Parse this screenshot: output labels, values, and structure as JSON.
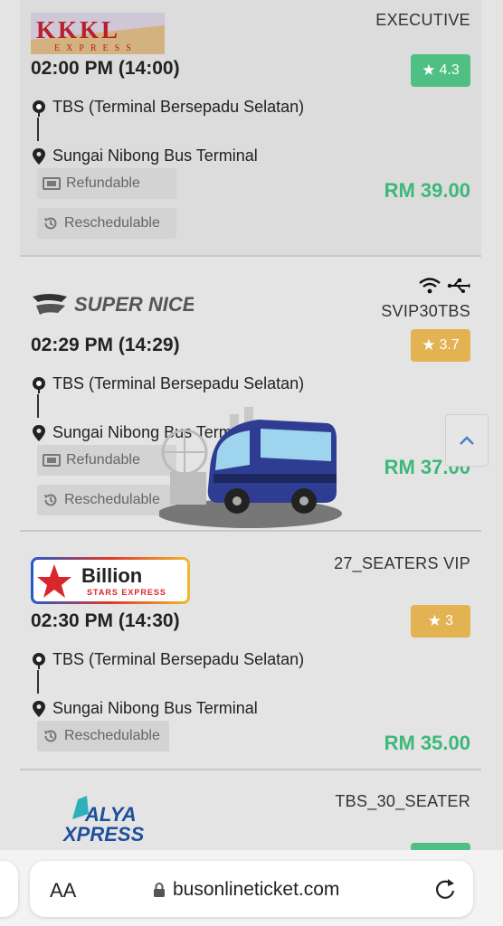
{
  "cards": [
    {
      "operator": "KKKL Express",
      "logo_text": "KKKL",
      "logo_sub": "EXPRESS",
      "bus_type": "EXECUTIVE",
      "time": "02:00 PM (14:00)",
      "rating": "4.3",
      "rating_color": "#4fbf83",
      "from": "TBS (Terminal Bersepadu Selatan)",
      "to": "Sungai Nibong Bus Terminal",
      "chips": [
        "Refundable",
        "Reschedulable"
      ],
      "price": "RM 39.00"
    },
    {
      "operator": "Super Nice",
      "logo_text": "SUPER NICE",
      "bus_type": "SVIP30TBS",
      "amenities": [
        "wifi-icon",
        "usb-icon"
      ],
      "time": "02:29 PM (14:29)",
      "rating": "3.7",
      "rating_color": "#e3b252",
      "from": "TBS (Terminal Bersepadu Selatan)",
      "to": "Sungai Nibong Bus Terminal",
      "chips": [
        "Refundable",
        "Reschedulable"
      ],
      "price": "RM 37.00"
    },
    {
      "operator": "Billion Stars Express",
      "logo_text": "Billion",
      "logo_sub": "STARS EXPRESS",
      "bus_type": "27_SEATERS VIP",
      "time": "02:30 PM (14:30)",
      "rating": "3",
      "rating_color": "#e3b252",
      "from": "TBS (Terminal Bersepadu Selatan)",
      "to": "Sungai Nibong Bus Terminal",
      "chips": [
        "Reschedulable"
      ],
      "price": "RM 35.00"
    },
    {
      "operator": "Alya Xpress",
      "logo_text": "ALYA",
      "logo_sub": "XPRESS",
      "bus_type": "TBS_30_SEATER",
      "rating_color": "#4fbf83"
    }
  ],
  "browser": {
    "text_size_label": "AA",
    "url": "busonlineticket.com"
  }
}
